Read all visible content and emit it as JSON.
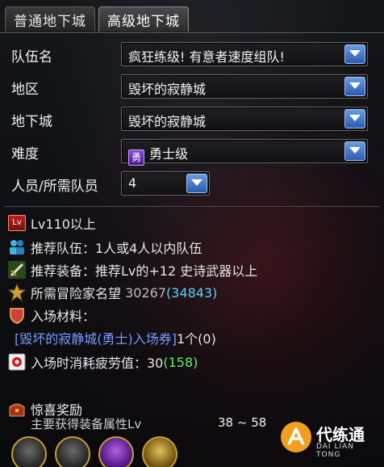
{
  "tabs": [
    {
      "label": "普通地下城",
      "active": false
    },
    {
      "label": "高级地下城",
      "active": true
    }
  ],
  "form": {
    "team_name": {
      "label": "队伍名",
      "value": "疯狂练级! 有意者速度组队!"
    },
    "region": {
      "label": "地区",
      "value": "毁坏的寂静城"
    },
    "dungeon": {
      "label": "地下城",
      "value": "毁坏的寂静城"
    },
    "difficulty": {
      "label": "难度",
      "badge": "勇",
      "value": "勇士级"
    },
    "members": {
      "label": "人员/所需队员",
      "value": "4"
    }
  },
  "info": {
    "level": {
      "icon": "Lv",
      "text": "Lv110以上"
    },
    "recommended_team": {
      "text": "推荐队伍：1人或4人以内队伍"
    },
    "recommended_gear": {
      "text": "推荐装备：推荐Lv的+12 史诗武器以上"
    },
    "reputation": {
      "text": "所需冒险家名望",
      "value": "30267",
      "extra": "(34843)"
    },
    "entry_material": {
      "text": "入场材料："
    },
    "ticket": {
      "text": "[毁坏的寂静城(勇士)入场券]",
      "count": "1个(0)"
    },
    "fatigue": {
      "text": "入场时消耗疲劳值：30",
      "extra": "(158)"
    }
  },
  "reward": {
    "title": "惊喜奖励",
    "subtitle": "主要获得装备属性Lv",
    "range": "38 ~ 58"
  },
  "watermark": {
    "name": "代练通",
    "sub": "DAI LIAN TONG"
  },
  "colors": {
    "accent_blue": "#2a5bb0",
    "reputation_cyan": "#5ad0ff",
    "green_value": "#5ef05e",
    "ticket_blue": "#7a9aff"
  },
  "icons": {
    "level": "level-badge-icon",
    "team": "team-icon",
    "gear": "sword-icon",
    "reputation": "reputation-icon",
    "material": "shield-icon",
    "fatigue": "fatigue-icon",
    "reward": "chest-icon"
  }
}
